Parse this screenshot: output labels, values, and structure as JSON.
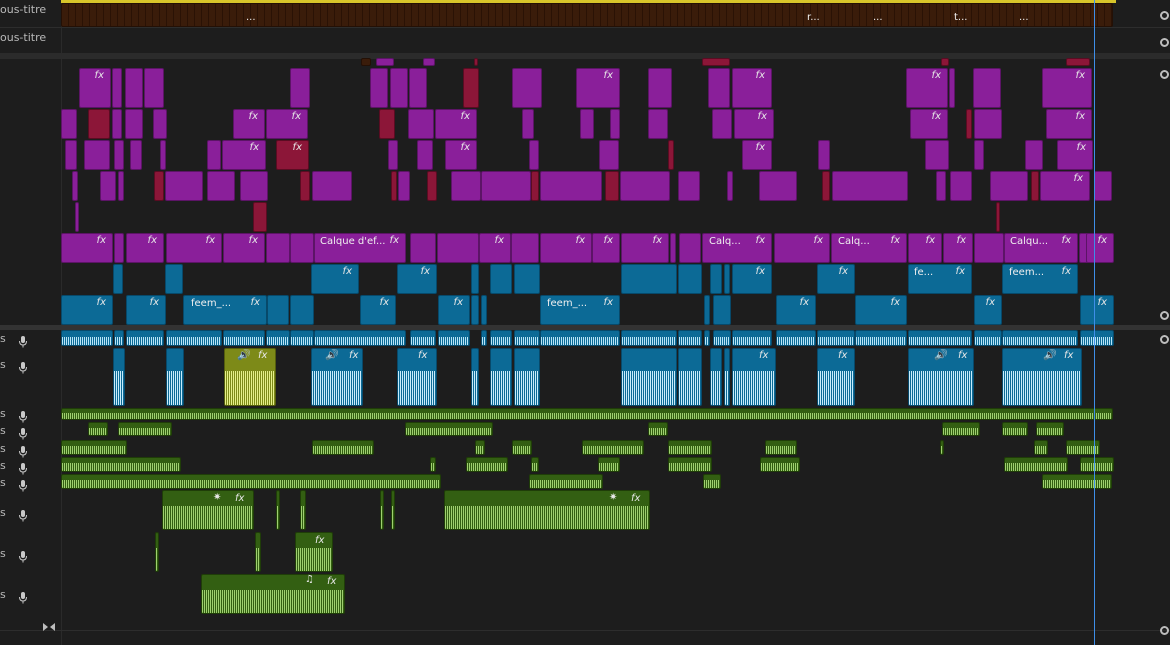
{
  "tracks": {
    "subtitle_1": {
      "label": "ous-titre",
      "clip_labels": [
        "...",
        "r...",
        "...",
        "t...",
        "..."
      ]
    },
    "subtitle_2": {
      "label": "ous-titre"
    },
    "audio_marker": "s"
  },
  "video_clip_labels": {
    "calque_1": "Calque d'ef...",
    "calque_2": "Calq...",
    "calque_3": "Calq...",
    "calque_4": "Calqu...",
    "feem_1": "feem_...",
    "feem_2": "feem_...",
    "fe_1": "fe...",
    "feem_3": "feem..."
  },
  "glyphs": {
    "fx": "fx",
    "star": "✷",
    "music": "♫",
    "speaker": "🔊",
    "mic": "mic-icon"
  },
  "colors": {
    "subtitle_clip": "#3a1c0a",
    "video_purple": "#8a1f9a",
    "video_red": "#8c1638",
    "video_blue": "#0c6a96",
    "audio_blue": "#0c6a96",
    "audio_green": "#335f12",
    "playhead": "#3e8ee8"
  }
}
